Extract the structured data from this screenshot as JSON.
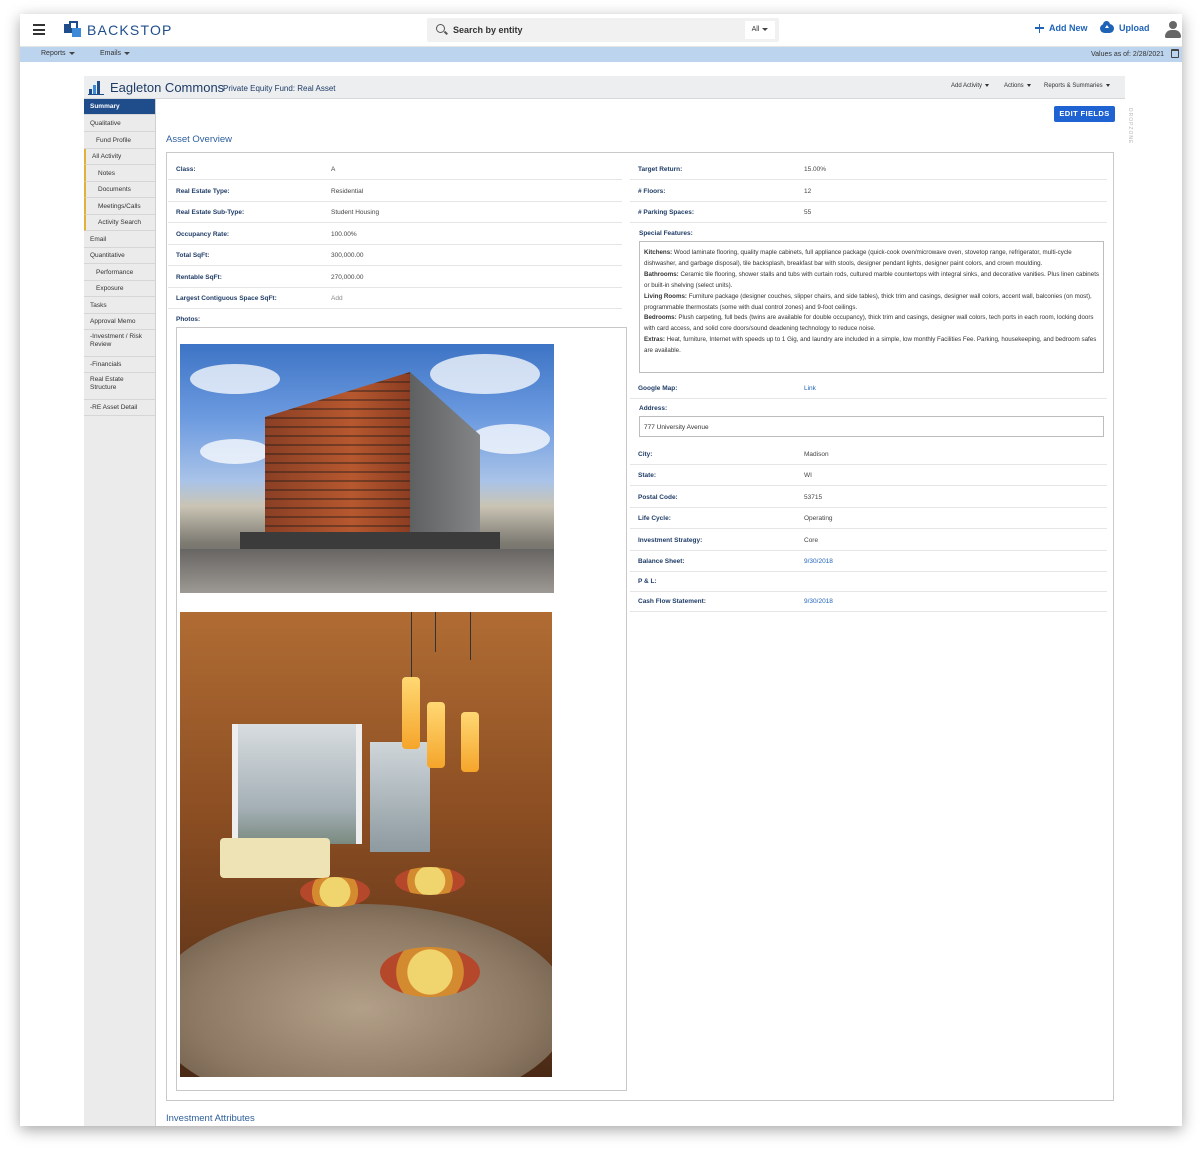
{
  "app": {
    "name": "BACKSTOP"
  },
  "search": {
    "placeholder": "Search by entity",
    "scope": "All"
  },
  "header_actions": {
    "add_new": "Add New",
    "upload": "Upload"
  },
  "subbar": {
    "reports": "Reports",
    "emails": "Emails",
    "values_as_of": "Values as of: 2/28/2021"
  },
  "entity": {
    "name": "Eagleton Commons",
    "subtitle": "Private Equity Fund: Real Asset",
    "actions": [
      "Add Activity",
      "Actions",
      "Reports & Summaries"
    ]
  },
  "nav": [
    {
      "label": "Summary"
    },
    {
      "label": "Qualitative"
    },
    {
      "label": "Fund Profile"
    },
    {
      "label": "All Activity"
    },
    {
      "label": "Notes"
    },
    {
      "label": "Documents"
    },
    {
      "label": "Meetings/Calls"
    },
    {
      "label": "Activity Search"
    },
    {
      "label": "Email"
    },
    {
      "label": "Quantitative"
    },
    {
      "label": "Performance"
    },
    {
      "label": "Exposure"
    },
    {
      "label": "Tasks"
    },
    {
      "label": "Approval Memo"
    },
    {
      "label": "-Investment / Risk Review"
    },
    {
      "label": "-Financials"
    },
    {
      "label": "Real Estate Structure"
    },
    {
      "label": "-RE Asset Detail"
    }
  ],
  "dropzone": "DROPZONE",
  "edit_fields": "EDIT FIELDS",
  "section_title": "Asset Overview",
  "section_title_2": "Investment Attributes",
  "left_fields": [
    {
      "label": "Class:",
      "value": "A"
    },
    {
      "label": "Real Estate Type:",
      "value": "Residential"
    },
    {
      "label": "Real Estate Sub-Type:",
      "value": "Student Housing"
    },
    {
      "label": "Occupancy Rate:",
      "value": "100.00%"
    },
    {
      "label": "Total SqFt:",
      "value": "300,000.00"
    },
    {
      "label": "Rentable SqFt:",
      "value": "270,000.00"
    },
    {
      "label": "Largest Contiguous Space SqFt:",
      "value": "Add"
    }
  ],
  "photos_label": "Photos:",
  "right_fields_top": [
    {
      "label": "Target Return:",
      "value": "15.00%"
    },
    {
      "label": "# Floors:",
      "value": "12"
    },
    {
      "label": "# Parking Spaces:",
      "value": "55"
    }
  ],
  "special_features": {
    "label": "Special Features:",
    "items": [
      {
        "head": "Kitchens:",
        "text": " Wood laminate flooring, quality maple cabinets, full appliance package (quick-cook oven/microwave oven, stovetop range, refrigerator, multi-cycle dishwasher, and garbage disposal), tile backsplash, breakfast bar with stools, designer pendant lights, designer paint colors, and crown moulding."
      },
      {
        "head": "Bathrooms:",
        "text": " Ceramic tile flooring, shower stalls and tubs with curtain rods, cultured marble countertops with integral sinks, and decorative vanities. Plus linen cabinets or built-in shelving (select units)."
      },
      {
        "head": "Living Rooms:",
        "text": " Furniture package (designer couches, slipper chairs, and side tables), thick trim and casings, designer wall colors, accent wall, balconies (on most), programmable thermostats (some with dual control zones) and 9-foot ceilings."
      },
      {
        "head": "Bedrooms:",
        "text": " Plush carpeting, full beds (twins are available for double occupancy), thick trim and casings, designer wall colors, tech ports in each room, locking doors with card access, and solid core doors/sound deadening technology to reduce noise."
      },
      {
        "head": "Extras:",
        "text": " Heat, furniture, Internet with speeds up to 1 Gig, and laundry are included in a simple, low monthly Facilities Fee. Parking, housekeeping, and bedroom safes are available."
      }
    ]
  },
  "google_map": {
    "label": "Google Map:",
    "value": "Link"
  },
  "address": {
    "label": "Address:",
    "value": "777 University Avenue"
  },
  "right_fields_bottom": [
    {
      "label": "City:",
      "value": "Madison"
    },
    {
      "label": "State:",
      "value": "WI"
    },
    {
      "label": "Postal Code:",
      "value": "53715"
    },
    {
      "label": "Life Cycle:",
      "value": "Operating"
    },
    {
      "label": "Investment Strategy:",
      "value": "Core"
    },
    {
      "label": "Balance Sheet:",
      "value": "9/30/2018"
    },
    {
      "label": "P & L:",
      "value": ""
    },
    {
      "label": "Cash Flow Statement:",
      "value": "9/30/2018"
    }
  ],
  "colors": {
    "brand": "#1f4d8c",
    "accent": "#1f63d2",
    "link": "#1f63b7",
    "subbar": "#bcd4ee"
  }
}
